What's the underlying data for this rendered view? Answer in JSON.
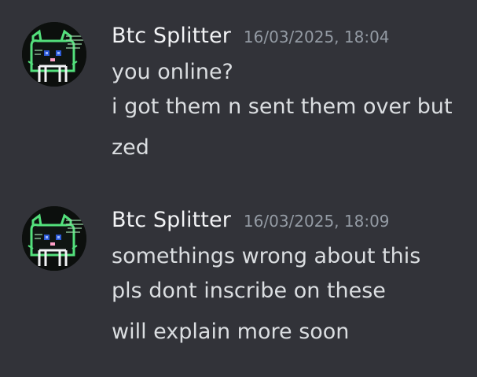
{
  "messages": [
    {
      "author": "Btc Splitter",
      "timestamp": "16/03/2025, 18:04",
      "lines": [
        "you online?",
        "i got them n sent them over but",
        "zed"
      ]
    },
    {
      "author": "Btc Splitter",
      "timestamp": "16/03/2025, 18:09",
      "lines": [
        "somethings wrong about this",
        "pls dont inscribe on these",
        "will explain more soon"
      ]
    }
  ],
  "colors": {
    "background": "#323339",
    "username": "#f2f3f5",
    "timestamp": "#949ba4",
    "text": "#dbdee1",
    "avatar_accent": "#53e07c",
    "avatar_eyes": "#2d5bd6",
    "avatar_nose": "#ff9fc6"
  },
  "icons": {
    "avatar": "pixel-cat-avatar-icon"
  }
}
